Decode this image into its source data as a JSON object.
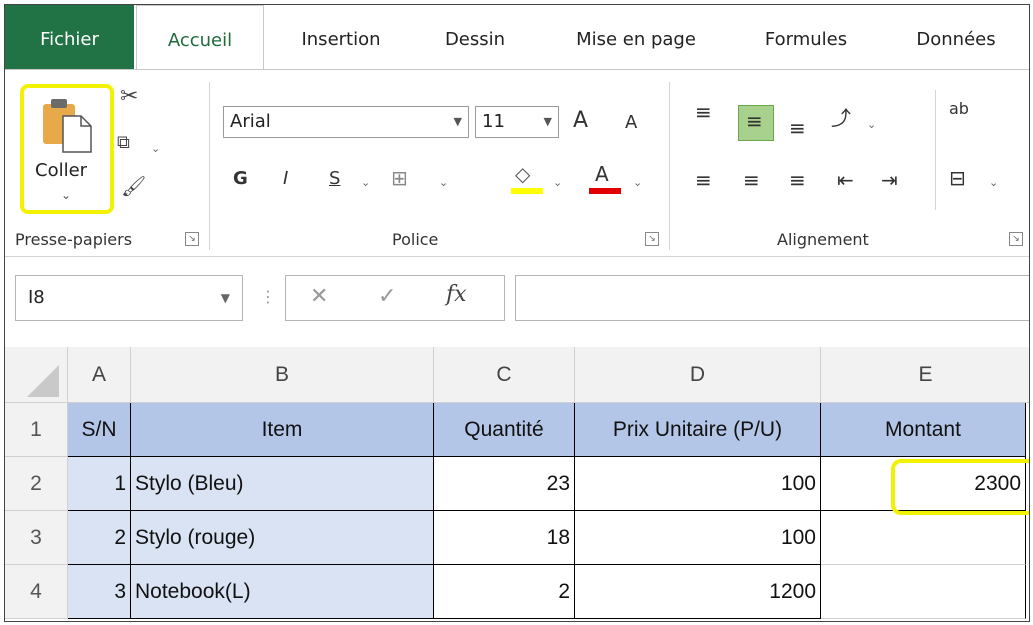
{
  "ribbon_tabs": {
    "file": "Fichier",
    "home": "Accueil",
    "insert": "Insertion",
    "draw": "Dessin",
    "layout": "Mise en page",
    "formulas": "Formules",
    "data": "Données"
  },
  "clipboard": {
    "paste_label": "Coller",
    "group_label": "Presse-papiers"
  },
  "font": {
    "name": "Arial",
    "size": "11",
    "bold_label": "G",
    "italic_label": "I",
    "underline_label": "S",
    "grow_label": "A",
    "shrink_label": "A",
    "color_label": "A",
    "group_label": "Police"
  },
  "alignment": {
    "group_label": "Alignement",
    "wrap_label": "ab"
  },
  "formula_bar": {
    "name_box": "I8",
    "fx_label": "fx",
    "formula": ""
  },
  "colors": {
    "file_tab": "#217346",
    "header_fill": "#b4c6e7",
    "band_fill": "#dae3f3",
    "highlight": "#f2f200"
  },
  "sheet": {
    "columns": [
      "A",
      "B",
      "C",
      "D",
      "E"
    ],
    "rows": [
      "1",
      "2",
      "3",
      "4"
    ],
    "header": [
      "S/N",
      "Item",
      "Quantité",
      "Prix Unitaire (P/U)",
      "Montant"
    ],
    "data": [
      [
        "1",
        "Stylo (Bleu)",
        "23",
        "100",
        "2300"
      ],
      [
        "2",
        "Stylo (rouge)",
        "18",
        "100",
        ""
      ],
      [
        "3",
        "Notebook(L)",
        "2",
        "1200",
        ""
      ]
    ]
  }
}
